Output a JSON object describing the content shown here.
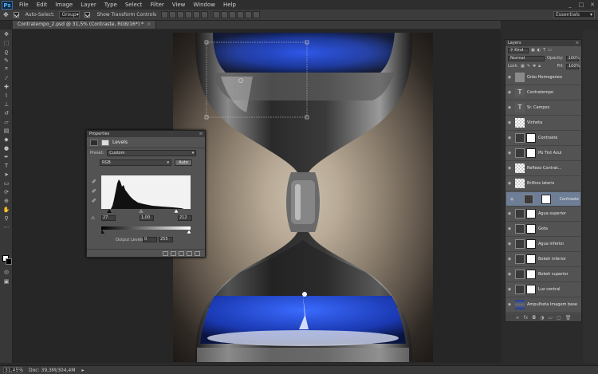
{
  "app": {
    "logo": "Ps"
  },
  "menu": [
    "File",
    "Edit",
    "Image",
    "Layer",
    "Type",
    "Select",
    "Filter",
    "View",
    "Window",
    "Help"
  ],
  "window_controls": [
    "_",
    "□",
    "✕"
  ],
  "options": {
    "auto_select_label": "Auto-Select:",
    "auto_select_value": "Group",
    "show_transform_label": "Show Transform Controls",
    "workspace": "Essentials"
  },
  "document_tab": {
    "title": "Contratempo_2.psd @ 31,5% (Contraste, RGB/16*) *",
    "close": "×"
  },
  "status": {
    "zoom": "31,45%",
    "doc": "Doc: 39,3M/304,4M"
  },
  "properties": {
    "panel_title": "Properties",
    "adjustment_title": "Levels",
    "preset_label": "Preset:",
    "preset_value": "Custom",
    "channel": "RGB",
    "auto_label": "Auto",
    "input_black": "27",
    "input_gamma": "1,00",
    "input_white": "212",
    "output_label": "Output Levels:",
    "output_black": "0",
    "output_white": "255"
  },
  "layers": {
    "panel_title": "Layers",
    "kind": "Kind",
    "blend_mode": "Normal",
    "opacity_label": "Opacity:",
    "opacity": "100%",
    "lock_label": "Lock:",
    "fill_label": "Fill:",
    "fill": "100%",
    "items": [
      {
        "name": "Grão Homogeneo",
        "thumb": "gray"
      },
      {
        "name": "Contratempo",
        "thumb": "text"
      },
      {
        "name": "Sr. Campos",
        "thumb": "text"
      },
      {
        "name": "Vinheta",
        "thumb": "checker"
      },
      {
        "name": "Contraste",
        "thumb": "adjust"
      },
      {
        "name": "Pb Tint Azul",
        "thumb": "adjust"
      },
      {
        "name": "Reflexo Contrat...",
        "thumb": "checker"
      },
      {
        "name": "Brilhos lateris",
        "thumb": "checker"
      },
      {
        "name": "Contraste",
        "thumb": "adjust",
        "selected": true
      },
      {
        "name": "Água superior",
        "thumb": "adjust"
      },
      {
        "name": "Gota",
        "thumb": "adjust"
      },
      {
        "name": "Água inferior",
        "thumb": "adjust"
      },
      {
        "name": "Bokeh inferior",
        "thumb": "adjust"
      },
      {
        "name": "Bokeh superior",
        "thumb": "adjust"
      },
      {
        "name": "Luz central",
        "thumb": "adjust"
      },
      {
        "name": "Ampulheta Imagem base",
        "thumb": "photo"
      }
    ]
  },
  "colors": {
    "accent": "#6e7e96",
    "panel": "#535353",
    "bokeh": "#1f4bd6"
  }
}
